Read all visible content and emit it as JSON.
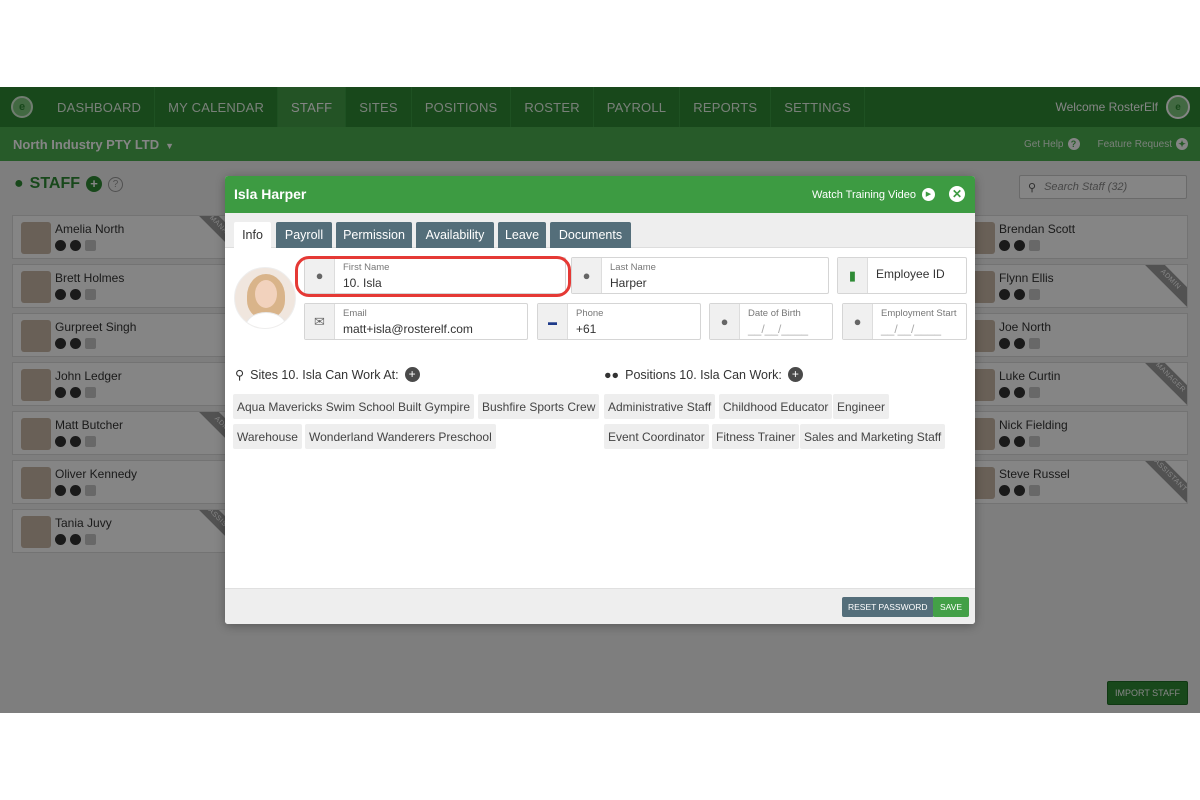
{
  "nav": {
    "items": [
      "DASHBOARD",
      "MY CALENDAR",
      "STAFF",
      "SITES",
      "POSITIONS",
      "ROSTER",
      "PAYROLL",
      "REPORTS",
      "SETTINGS"
    ],
    "active": "STAFF",
    "welcome": "Welcome RosterElf"
  },
  "subnav": {
    "company": "North Industry PTY LTD",
    "get_help": "Get Help",
    "feature_request": "Feature Request"
  },
  "staff_page": {
    "title": "STAFF",
    "search_placeholder": "Search Staff (32)",
    "left_cards": [
      {
        "name": "Amelia North",
        "ribbon": "MANAGER"
      },
      {
        "name": "Brett Holmes",
        "ribbon": ""
      },
      {
        "name": "Gurpreet Singh",
        "ribbon": ""
      },
      {
        "name": "John Ledger",
        "ribbon": ""
      },
      {
        "name": "Matt Butcher",
        "ribbon": "ADMIN"
      },
      {
        "name": "Oliver Kennedy",
        "ribbon": ""
      },
      {
        "name": "Tania Juvy",
        "ribbon": "ASSISTANT"
      }
    ],
    "right_cards": [
      {
        "name": "Brendan Scott",
        "ribbon": ""
      },
      {
        "name": "Flynn Ellis",
        "ribbon": "ADMIN"
      },
      {
        "name": "Joe North",
        "ribbon": ""
      },
      {
        "name": "Luke Curtin",
        "ribbon": "MANAGER"
      },
      {
        "name": "Nick Fielding",
        "ribbon": ""
      },
      {
        "name": "Steve Russel",
        "ribbon": "ASSISTANT"
      }
    ],
    "import_button": "IMPORT STAFF"
  },
  "modal": {
    "title": "Isla Harper",
    "watch_video": "Watch Training Video",
    "tabs": [
      "Info",
      "Payroll",
      "Permission",
      "Availability",
      "Leave",
      "Documents"
    ],
    "active_tab": "Info",
    "fields": {
      "first_name": {
        "label": "First Name",
        "value": "10. Isla"
      },
      "last_name": {
        "label": "Last Name",
        "value": "Harper"
      },
      "employee_id": {
        "label": "Employee ID"
      },
      "email": {
        "label": "Email",
        "value": "matt+isla@rosterelf.com"
      },
      "phone": {
        "label": "Phone",
        "value": "+61"
      },
      "dob": {
        "label": "Date of Birth",
        "value": "__/__/____"
      },
      "employment_start": {
        "label": "Employment Start",
        "value": "__/__/____"
      }
    },
    "sites_heading": "Sites 10. Isla Can Work At:",
    "sites": [
      "Aqua Mavericks Swim School",
      "Built Gympire",
      "Bushfire Sports Crew",
      "Warehouse",
      "Wonderland Wanderers Preschool"
    ],
    "positions_heading": "Positions 10. Isla Can Work:",
    "positions": [
      "Administrative Staff",
      "Childhood Educator",
      "Engineer",
      "Event Coordinator",
      "Fitness Trainer",
      "Sales and Marketing Staff"
    ],
    "reset_password": "RESET PASSWORD",
    "save": "SAVE"
  }
}
